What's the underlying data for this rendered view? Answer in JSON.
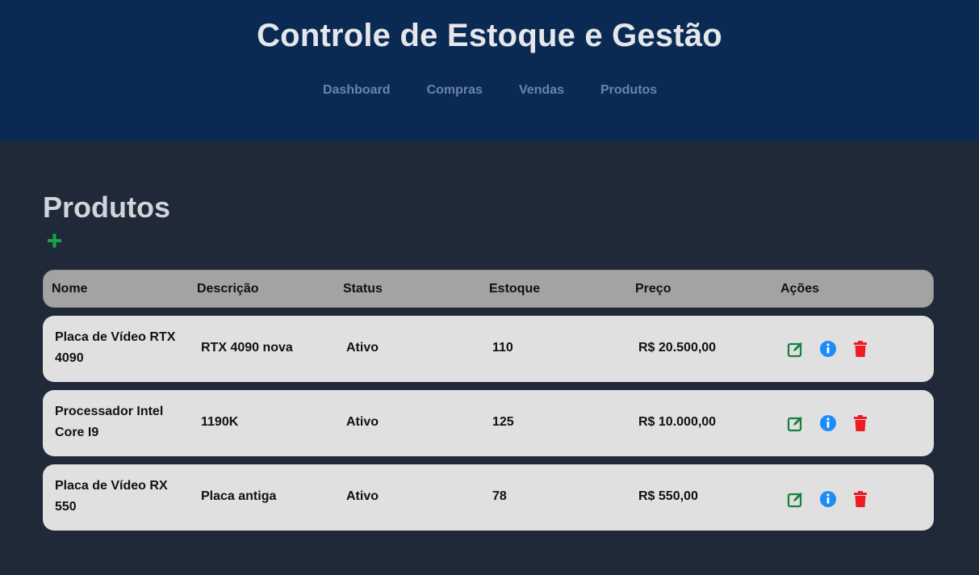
{
  "header": {
    "title": "Controle de Estoque e Gestão",
    "nav": [
      "Dashboard",
      "Compras",
      "Vendas",
      "Produtos"
    ]
  },
  "main": {
    "title": "Produtos",
    "add_icon": "plus-icon",
    "table": {
      "columns": [
        "Nome",
        "Descrição",
        "Status",
        "Estoque",
        "Preço",
        "Ações"
      ],
      "rows": [
        {
          "nome": "Placa de Vídeo RTX 4090",
          "descricao": "RTX 4090 nova",
          "status": "Ativo",
          "estoque": "110",
          "preco": "R$ 20.500,00"
        },
        {
          "nome": "Processador Intel Core I9",
          "descricao": "1190K",
          "status": "Ativo",
          "estoque": "125",
          "preco": "R$ 10.000,00"
        },
        {
          "nome": "Placa de Vídeo RX 550",
          "descricao": "Placa antiga",
          "status": "Ativo",
          "estoque": "78",
          "preco": "R$ 550,00"
        }
      ]
    }
  },
  "colors": {
    "header_bg": "#0b2a53",
    "page_bg": "#1f2937",
    "edit": "#15803d",
    "info": "#1d8cf8",
    "delete": "#ef1c24",
    "add": "#16a34a"
  },
  "icons": {
    "edit": "edit-icon",
    "info": "info-icon",
    "delete": "trash-icon"
  }
}
